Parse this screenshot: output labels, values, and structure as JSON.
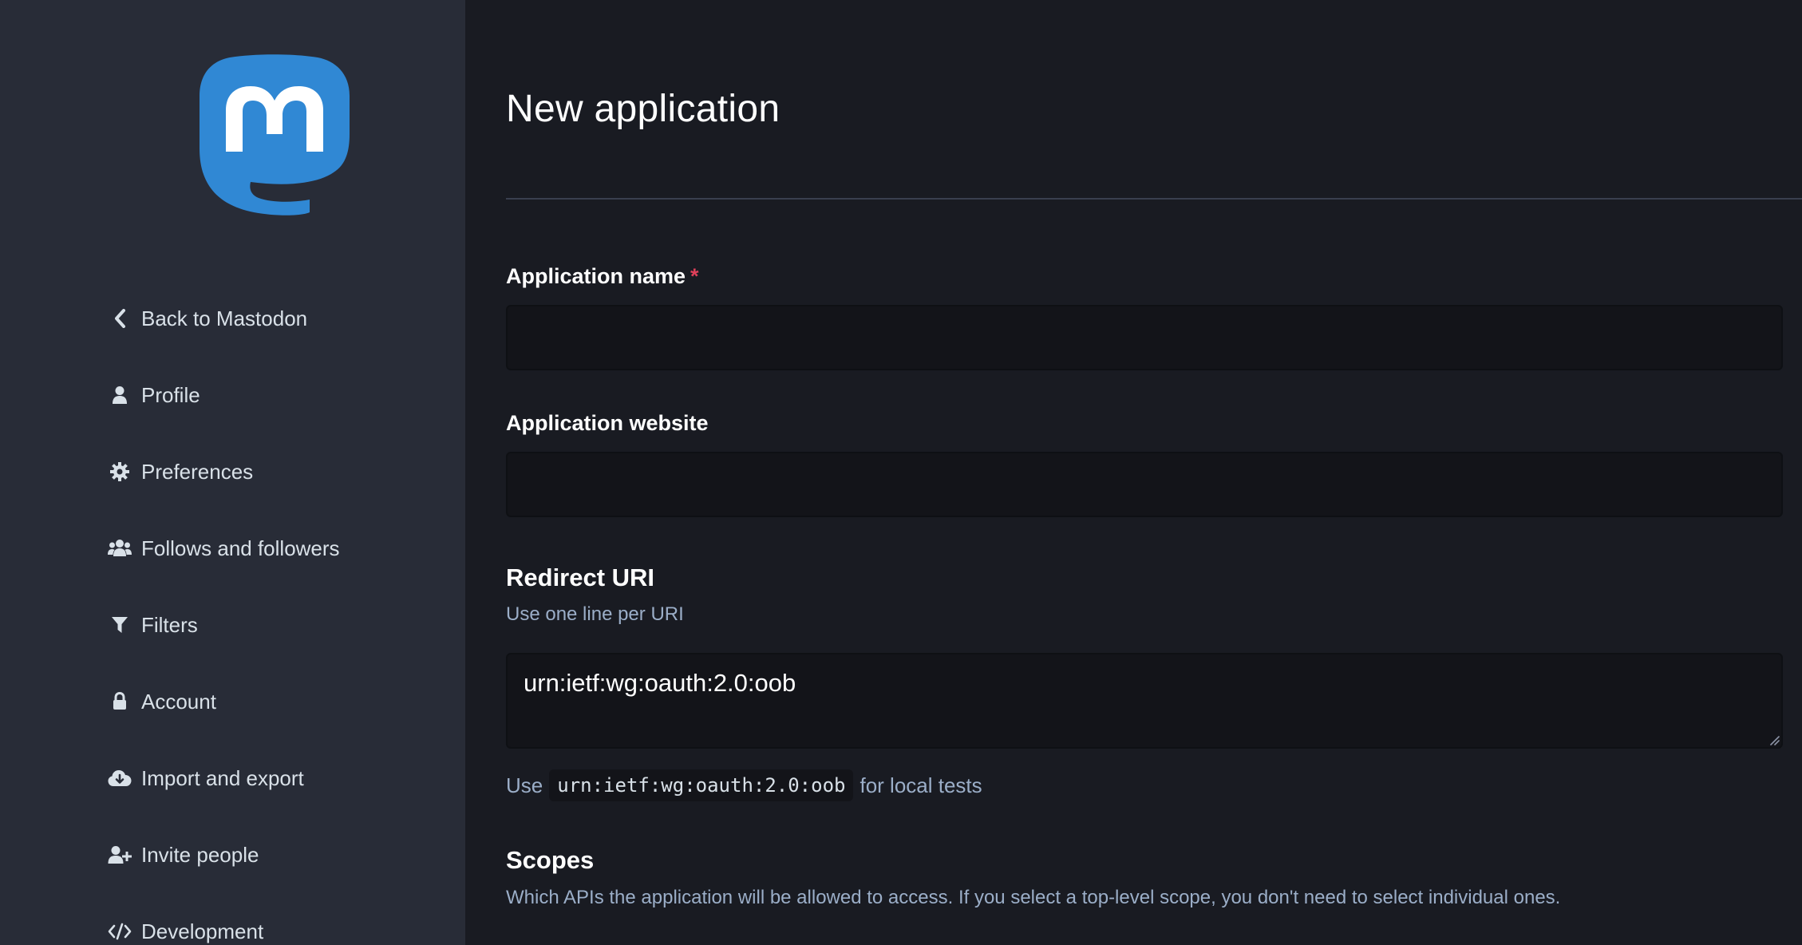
{
  "sidebar": {
    "logo_icon": "mastodon-logo-icon",
    "items": [
      {
        "label": "Back to Mastodon",
        "icon": "chevron-left-icon"
      },
      {
        "label": "Profile",
        "icon": "user-icon"
      },
      {
        "label": "Preferences",
        "icon": "gear-icon"
      },
      {
        "label": "Follows and followers",
        "icon": "users-icon"
      },
      {
        "label": "Filters",
        "icon": "filter-icon"
      },
      {
        "label": "Account",
        "icon": "lock-icon"
      },
      {
        "label": "Import and export",
        "icon": "cloud-download-icon"
      },
      {
        "label": "Invite people",
        "icon": "user-plus-icon"
      },
      {
        "label": "Development",
        "icon": "code-icon"
      }
    ]
  },
  "main": {
    "title": "New application",
    "fields": {
      "app_name": {
        "label": "Application name",
        "required_mark": "*",
        "value": ""
      },
      "app_website": {
        "label": "Application website",
        "value": ""
      },
      "redirect_uri": {
        "heading": "Redirect URI",
        "hint": "Use one line per URI",
        "value": "urn:ietf:wg:oauth:2.0:oob",
        "note_prefix": "Use",
        "note_code": "urn:ietf:wg:oauth:2.0:oob",
        "note_suffix": "for local tests"
      },
      "scopes": {
        "heading": "Scopes",
        "hint": "Which APIs the application will be allowed to access. If you select a top-level scope, you don't need to select individual ones."
      }
    }
  },
  "colors": {
    "sidebar_bg": "#282c37",
    "main_bg": "#191b22",
    "input_bg": "#131419",
    "brand_blue": "#6364ff",
    "logo_blue": "#3088d4",
    "required_red": "#df405a",
    "muted_text": "#9baec8"
  }
}
